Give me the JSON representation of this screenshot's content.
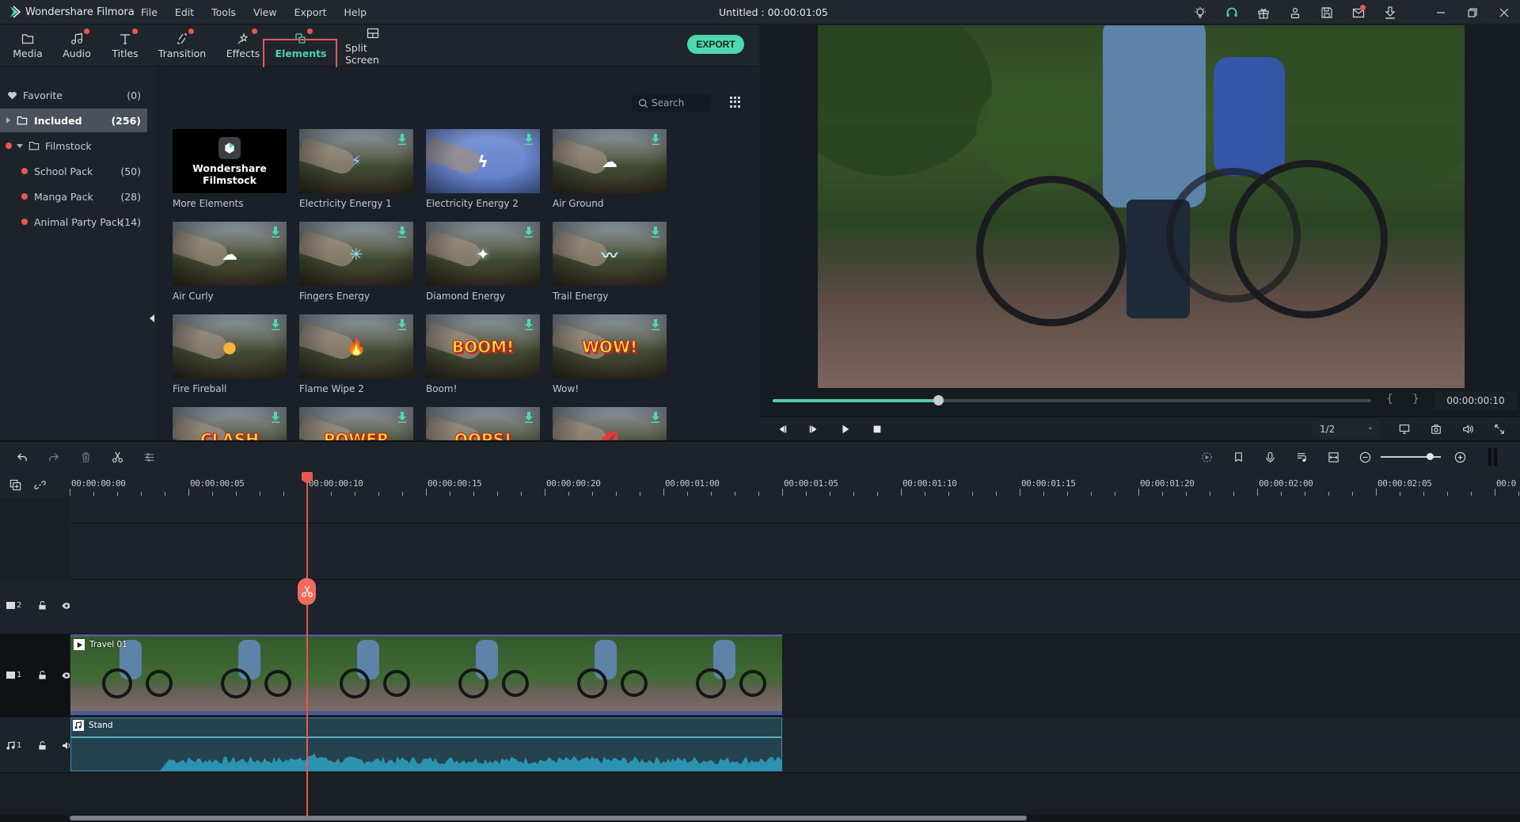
{
  "app": {
    "name": "Wondershare Filmora",
    "document_title": "Untitled : 00:00:01:05",
    "menu": [
      "File",
      "Edit",
      "Tools",
      "View",
      "Export",
      "Help"
    ],
    "title_icons": [
      "lightbulb-icon",
      "headset-icon",
      "gift-icon",
      "account-icon",
      "save-icon",
      "mail-icon",
      "download-icon"
    ],
    "window_controls": [
      "minimize",
      "restore",
      "close"
    ]
  },
  "tabs": [
    {
      "label": "Media",
      "icon": "folder-icon",
      "badge": false
    },
    {
      "label": "Audio",
      "icon": "music-icon",
      "badge": true
    },
    {
      "label": "Titles",
      "icon": "text-icon",
      "badge": true
    },
    {
      "label": "Transition",
      "icon": "transition-icon",
      "badge": true
    },
    {
      "label": "Effects",
      "icon": "effects-icon",
      "badge": true
    },
    {
      "label": "Elements",
      "icon": "elements-icon",
      "badge": true,
      "active": true
    },
    {
      "label": "Split Screen",
      "icon": "split-screen-icon",
      "badge": false
    }
  ],
  "export_label": "EXPORT",
  "sidebar": {
    "items": [
      {
        "label": "Favorite",
        "count": "(0)",
        "icon": "heart-icon"
      },
      {
        "label": "Included",
        "count": "(256)",
        "icon": "folder-icon",
        "selected": true
      },
      {
        "label": "Filmstock",
        "count": "",
        "icon": "folder-icon",
        "expanded": true
      },
      {
        "label": "School Pack",
        "count": "(50)"
      },
      {
        "label": "Manga Pack",
        "count": "(28)"
      },
      {
        "label": "Animal Party Pack",
        "count": "(14)"
      }
    ]
  },
  "search": {
    "placeholder": "Search"
  },
  "filmstock_card": {
    "line1": "Wondershare",
    "line2": "Filmstock",
    "label": "More Elements"
  },
  "elements": [
    {
      "label": "Electricity Energy 1",
      "fx": "electricity"
    },
    {
      "label": "Electricity Energy 2",
      "fx": "lightning"
    },
    {
      "label": "Air Ground",
      "fx": "air"
    },
    {
      "label": "Air Curly",
      "fx": "air"
    },
    {
      "label": "Fingers Energy",
      "fx": "energy"
    },
    {
      "label": "Diamond Energy",
      "fx": "diamond"
    },
    {
      "label": "Trail Energy",
      "fx": "trail"
    },
    {
      "label": "Fire Fireball",
      "fx": "fireball"
    },
    {
      "label": "Flame Wipe 2",
      "fx": "flame"
    },
    {
      "label": "Boom!",
      "fx": "BOOM!"
    },
    {
      "label": "Wow!",
      "fx": "WOW!"
    },
    {
      "label": "",
      "fx": "CLASH"
    },
    {
      "label": "",
      "fx": "POWER"
    },
    {
      "label": "",
      "fx": "OOPS!"
    },
    {
      "label": "",
      "fx": "lips"
    }
  ],
  "preview": {
    "timecode": "00:00:00:10",
    "progress": 0.276,
    "quality": "1/2"
  },
  "timeline": {
    "ruler_labels": [
      "00:00:00:00",
      "00:00:00:05",
      "00:00:00:10",
      "00:00:00:15",
      "00:00:00:20",
      "00:00:01:00",
      "00:00:01:05",
      "00:00:01:10",
      "00:00:01:15",
      "00:00:01:20",
      "00:00:02:00",
      "00:00:02:05",
      "00:0"
    ],
    "playhead_time": "00:00:00:10",
    "zoom_level": 0.82,
    "scroll_fraction": 0.66,
    "tracks": [
      {
        "id": "video-2",
        "label": "2",
        "type": "video"
      },
      {
        "id": "video-1",
        "label": "1",
        "type": "video"
      },
      {
        "id": "audio-1",
        "label": "1",
        "type": "audio"
      }
    ],
    "clips": {
      "video": {
        "name": "Travel 01"
      },
      "audio": {
        "name": "Stand"
      }
    }
  },
  "colors": {
    "accent": "#4fd1ad",
    "badge": "#e8574f",
    "playhead": "#e8574f",
    "highlight_box": "#e05a5a"
  }
}
